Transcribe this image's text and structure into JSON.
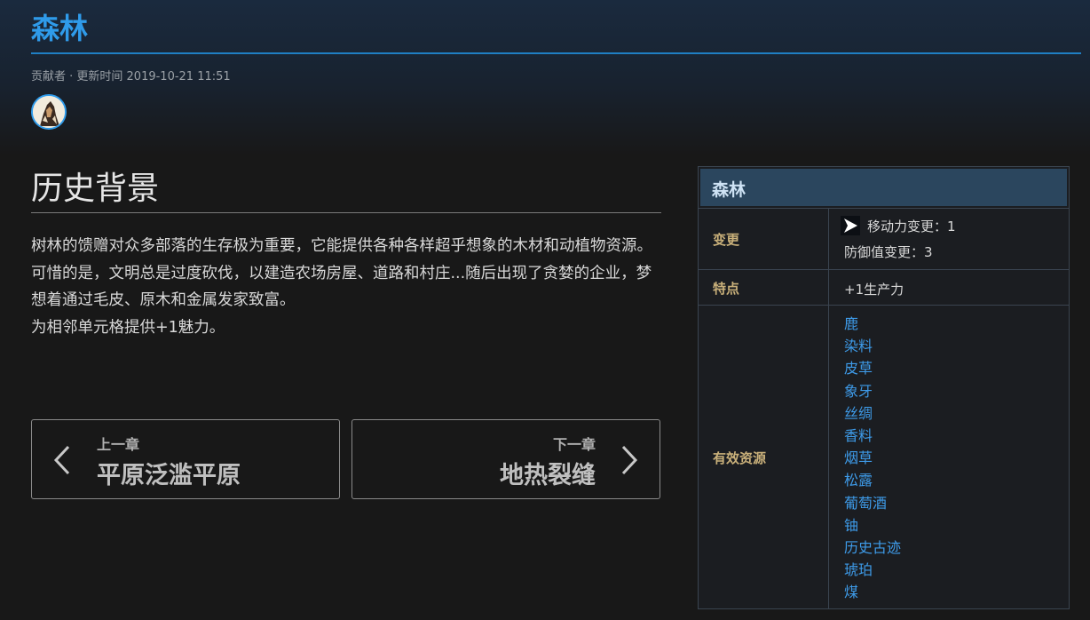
{
  "page": {
    "title": "森林",
    "meta": "贡献者 · 更新时间 2019-10-21 11:51"
  },
  "section": {
    "title": "历史背景",
    "paragraph1": "树林的馈赠对众多部落的生存极为重要，它能提供各种各样超乎想象的木材和动植物资源。可惜的是，文明总是过度砍伐，以建造农场房屋、道路和村庄...随后出现了贪婪的企业，梦想着通过毛皮、原木和金属发家致富。",
    "paragraph2": "为相邻单元格提供+1魅力。"
  },
  "nav": {
    "prev_label": "上一章",
    "prev_title": "平原泛滥平原",
    "next_label": "下一章",
    "next_title": "地热裂缝"
  },
  "infobox": {
    "title": "森林",
    "change_label": "变更",
    "change_line1": "移动力变更：1",
    "change_line2": "防御值变更：3",
    "feature_label": "特点",
    "feature_value": "+1生产力",
    "resources_label": "有效资源",
    "resources": [
      "鹿",
      "染料",
      "皮草",
      "象牙",
      "丝绸",
      "香料",
      "烟草",
      "松露",
      "葡萄酒",
      "铀",
      "历史古迹",
      "琥珀",
      "煤"
    ]
  },
  "colors": {
    "accent": "#2f9bea",
    "link": "#3e9be9",
    "label": "#c9b07a",
    "infobox_header": "#2b465e"
  },
  "icons": {
    "avatar": "contributor-avatar",
    "prev": "chevron-left-icon",
    "next": "chevron-right-icon",
    "movement": "movement-arrow-icon"
  }
}
